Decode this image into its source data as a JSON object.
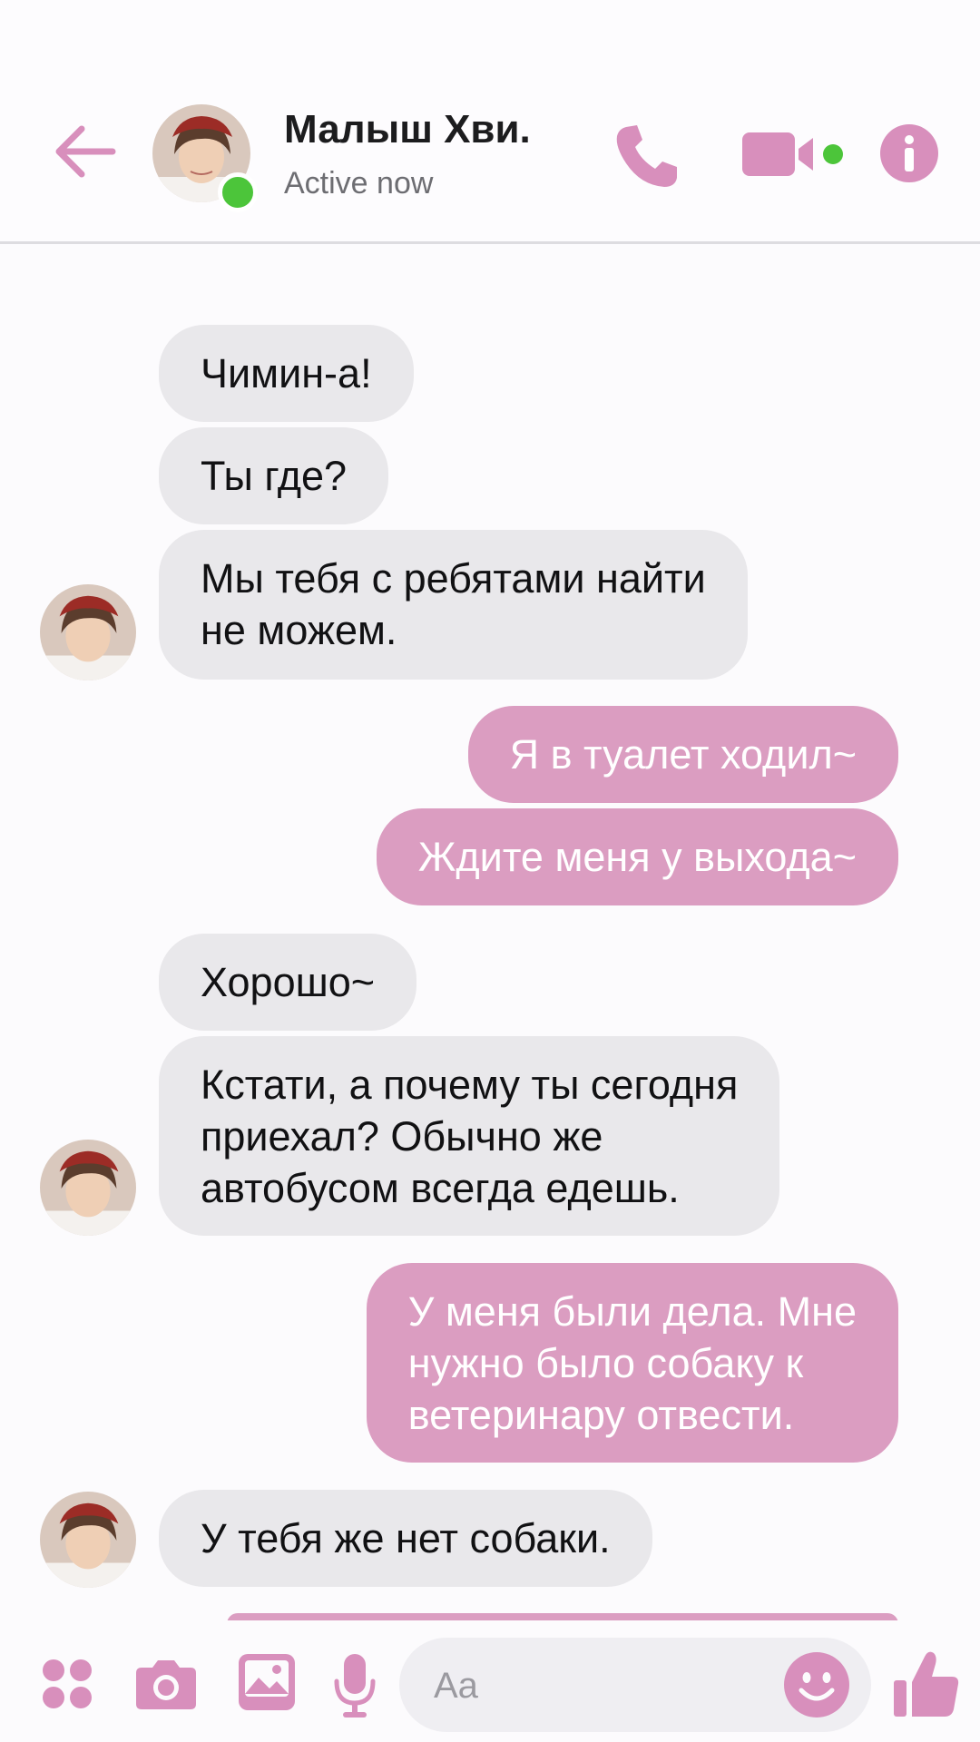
{
  "header": {
    "contact_name": "Малыш Хви.",
    "status": "Active now"
  },
  "messages": [
    {
      "sender": "them",
      "text": "Чимин-а!"
    },
    {
      "sender": "them",
      "text": "Ты где?"
    },
    {
      "sender": "them",
      "text": "Мы тебя с ребятами найти\nне можем."
    },
    {
      "sender": "me",
      "text": "Я в туалет ходил~"
    },
    {
      "sender": "me",
      "text": "Ждите меня у выхода~"
    },
    {
      "sender": "them",
      "text": "Хорошо~"
    },
    {
      "sender": "them",
      "text": "Кстати, а почему ты сегодня\nприехал? Обычно же\nавтобусом всегда едешь."
    },
    {
      "sender": "me",
      "text": "У меня были дела. Мне\nнужно было собаку к\nветеринару отвести."
    },
    {
      "sender": "them",
      "text": "У тебя же нет собаки."
    }
  ],
  "composer": {
    "placeholder": "Aa"
  },
  "icons": {
    "back": "arrow-left-icon",
    "call": "phone-icon",
    "video": "video-camera-icon",
    "info": "info-icon",
    "menu": "four-dots-icon",
    "camera": "camera-icon",
    "gallery": "image-icon",
    "mic": "microphone-icon",
    "emoji": "smiley-icon",
    "like": "thumbs-up-icon"
  },
  "colors": {
    "accent": "#db9dc1",
    "incoming_bubble": "#e9e8eb",
    "online": "#4cc53a"
  }
}
